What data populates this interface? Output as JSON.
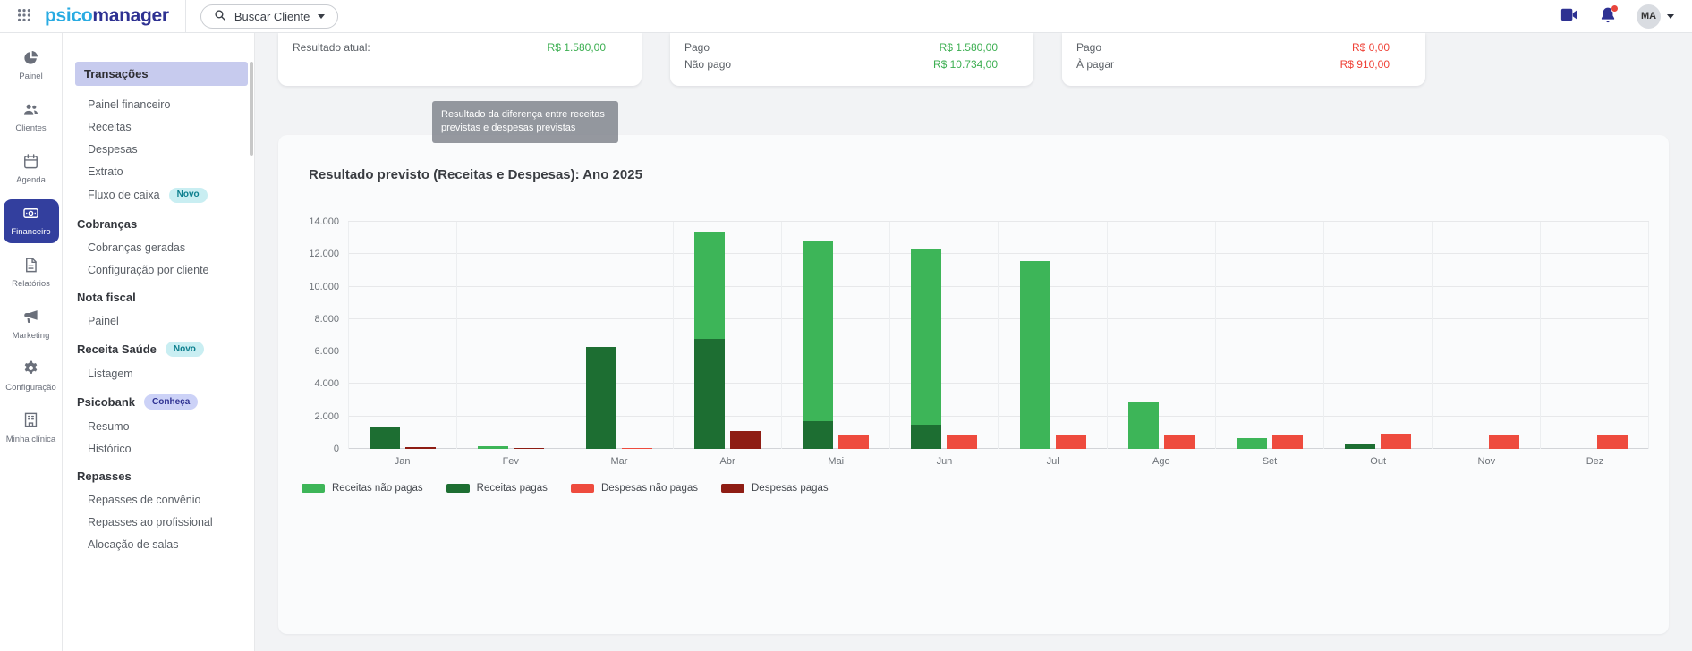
{
  "header": {
    "logo_part1": "psico",
    "logo_part2": "manager",
    "search_label": "Buscar Cliente",
    "avatar_initials": "MA"
  },
  "nav_rail": {
    "items": [
      {
        "label": "Painel",
        "icon": "pie-chart-icon",
        "active": false
      },
      {
        "label": "Clientes",
        "icon": "people-icon",
        "active": false
      },
      {
        "label": "Agenda",
        "icon": "calendar-icon",
        "active": false
      },
      {
        "label": "Financeiro",
        "icon": "money-icon",
        "active": true
      },
      {
        "label": "Relatórios",
        "icon": "report-icon",
        "active": false
      },
      {
        "label": "Marketing",
        "icon": "megaphone-icon",
        "active": false
      },
      {
        "label": "Configuração",
        "icon": "gear-icon",
        "active": false
      },
      {
        "label": "Minha clínica",
        "icon": "building-icon",
        "active": false
      }
    ]
  },
  "sidebar": {
    "items": [
      {
        "label": "Transações",
        "type": "section-active"
      },
      {
        "label": "Painel financeiro",
        "type": "link"
      },
      {
        "label": "Receitas",
        "type": "link"
      },
      {
        "label": "Despesas",
        "type": "link"
      },
      {
        "label": "Extrato",
        "type": "link"
      },
      {
        "label": "Fluxo de caixa",
        "type": "link",
        "badge": "Novo"
      },
      {
        "label": "Cobranças",
        "type": "section"
      },
      {
        "label": "Cobranças geradas",
        "type": "link"
      },
      {
        "label": "Configuração por cliente",
        "type": "link"
      },
      {
        "label": "Nota fiscal",
        "type": "section"
      },
      {
        "label": "Painel",
        "type": "link"
      },
      {
        "label": "Receita Saúde",
        "type": "section",
        "badge": "Novo"
      },
      {
        "label": "Listagem",
        "type": "link"
      },
      {
        "label": "Psicobank",
        "type": "section",
        "badge": "Conheça"
      },
      {
        "label": "Resumo",
        "type": "link"
      },
      {
        "label": "Histórico",
        "type": "link"
      },
      {
        "label": "Repasses",
        "type": "section"
      },
      {
        "label": "Repasses de convênio",
        "type": "link"
      },
      {
        "label": "Repasses ao profissional",
        "type": "link"
      },
      {
        "label": "Alocação de salas",
        "type": "link"
      }
    ]
  },
  "summary_cards": [
    {
      "rows": [
        {
          "label": "Resultado atual:",
          "value": "R$ 1.580,00",
          "tone": "positive"
        }
      ]
    },
    {
      "rows": [
        {
          "label": "Pago",
          "value": "R$ 1.580,00",
          "tone": "positive"
        },
        {
          "label": "Não pago",
          "value": "R$ 10.734,00",
          "tone": "positive"
        }
      ]
    },
    {
      "rows": [
        {
          "label": "Pago",
          "value": "R$ 0,00",
          "tone": "negative"
        },
        {
          "label": "À pagar",
          "value": "R$ 910,00",
          "tone": "negative"
        }
      ]
    }
  ],
  "tooltip": {
    "text": "Resultado da diferença entre receitas previstas e despesas previstas"
  },
  "chart_data": {
    "type": "bar",
    "stacked": true,
    "title": "Resultado previsto (Receitas e Despesas): Ano 2025",
    "categories": [
      "Jan",
      "Fev",
      "Mar",
      "Abr",
      "Mai",
      "Jun",
      "Jul",
      "Ago",
      "Set",
      "Out",
      "Nov",
      "Dez"
    ],
    "series": [
      {
        "name": "Receitas não pagas",
        "stack": "receitas",
        "color": "#3db558",
        "values": [
          0,
          150,
          0,
          6600,
          11100,
          10800,
          11600,
          2900,
          650,
          0,
          0,
          0
        ]
      },
      {
        "name": "Receitas pagas",
        "stack": "receitas",
        "color": "#1d6e32",
        "values": [
          1400,
          0,
          6300,
          6800,
          1700,
          1500,
          0,
          0,
          0,
          250,
          0,
          0
        ]
      },
      {
        "name": "Despesas não pagas",
        "stack": "despesas",
        "color": "#ee4b3e",
        "values": [
          0,
          0,
          80,
          0,
          900,
          900,
          900,
          850,
          850,
          950,
          850,
          850
        ]
      },
      {
        "name": "Despesas pagas",
        "stack": "despesas",
        "color": "#8e1d14",
        "values": [
          120,
          60,
          0,
          1100,
          0,
          0,
          0,
          0,
          0,
          0,
          0,
          0
        ]
      }
    ],
    "ylim": [
      0,
      14000
    ],
    "yticks": [
      "0",
      "2.000",
      "4.000",
      "6.000",
      "8.000",
      "10.000",
      "12.000",
      "14.000"
    ],
    "legend_position": "bottom",
    "grid": true
  },
  "colors": {
    "brand_light_blue": "#29abe2",
    "brand_dark_blue": "#2e3192",
    "active_rail_bg": "#333f9e",
    "active_submenu_bg": "#c7cbee",
    "positive_value": "#3daf52",
    "negative_value": "#ef4136",
    "badge_teal_bg": "#c9eef2",
    "badge_teal_text": "#0c7f8e",
    "badge_indigo_bg": "#ccd2f7",
    "badge_indigo_text": "#2e3192"
  }
}
